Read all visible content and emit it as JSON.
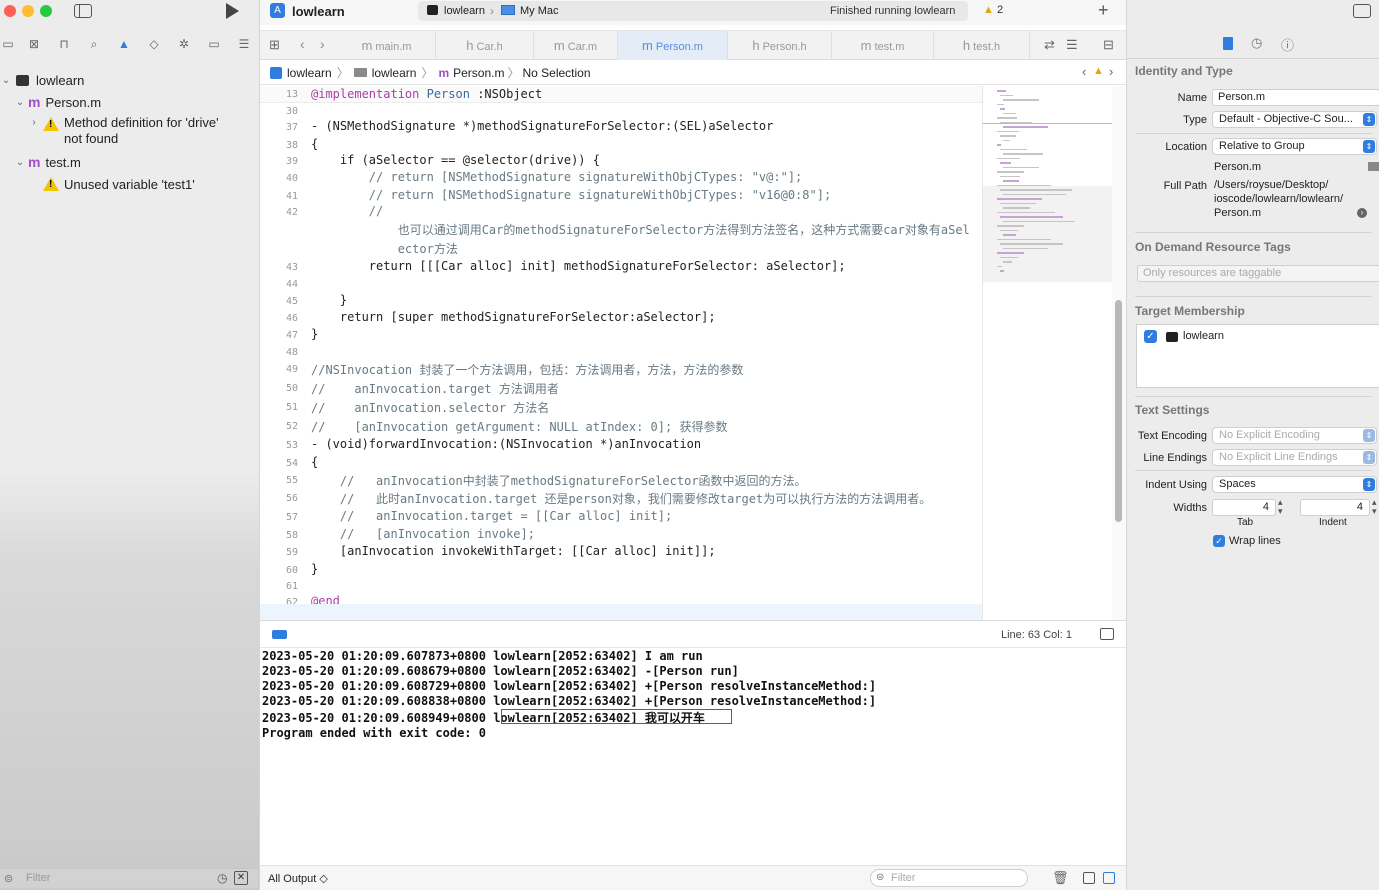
{
  "window": {
    "project": "lowlearn",
    "scheme_target": "lowlearn",
    "scheme_device": "My Mac",
    "status": "Finished running lowlearn",
    "warning_count": "2"
  },
  "navigator": {
    "root": "lowlearn",
    "items": [
      {
        "name": "Person.m",
        "kind": "file"
      },
      {
        "name": "Method definition for 'drive' not found",
        "kind": "warning"
      },
      {
        "name": "test.m",
        "kind": "file"
      },
      {
        "name": "Unused variable 'test1'",
        "kind": "warning"
      }
    ],
    "filter_placeholder": "Filter"
  },
  "tabs": [
    {
      "icon": "m",
      "label": "main.m"
    },
    {
      "icon": "h",
      "label": "Car.h"
    },
    {
      "icon": "m",
      "label": "Car.m"
    },
    {
      "icon": "m",
      "label": "Person.m",
      "active": true
    },
    {
      "icon": "h",
      "label": "Person.h"
    },
    {
      "icon": "m",
      "label": "test.m"
    },
    {
      "icon": "h",
      "label": "test.h"
    }
  ],
  "jumpbar": {
    "project": "lowlearn",
    "folder": "lowlearn",
    "file": "Person.m",
    "selection": "No Selection"
  },
  "code": {
    "sticky": {
      "line": "13",
      "text": "@implementation Person :NSObject"
    },
    "lines": [
      {
        "n": "30",
        "t": ""
      },
      {
        "n": "37",
        "t": "- (NSMethodSignature *)methodSignatureForSelector:(SEL)aSelector"
      },
      {
        "n": "38",
        "t": "{"
      },
      {
        "n": "39",
        "t": "    if (aSelector == @selector(drive)) {"
      },
      {
        "n": "40",
        "t": "        // return [NSMethodSignature signatureWithObjCTypes: \"v@:\"];"
      },
      {
        "n": "41",
        "t": "        // return [NSMethodSignature signatureWithObjCTypes: \"v16@0:8\"];"
      },
      {
        "n": "42",
        "t": "        //"
      },
      {
        "n": "",
        "t": "            也可以通过调用Car的methodSignatureForSelector方法得到方法签名，这种方式需要car对象有aSel"
      },
      {
        "n": "",
        "t": "            ector方法"
      },
      {
        "n": "43",
        "t": "        return [[[Car alloc] init] methodSignatureForSelector: aSelector];"
      },
      {
        "n": "44",
        "t": ""
      },
      {
        "n": "45",
        "t": "    }"
      },
      {
        "n": "46",
        "t": "    return [super methodSignatureForSelector:aSelector];"
      },
      {
        "n": "47",
        "t": "}"
      },
      {
        "n": "48",
        "t": ""
      },
      {
        "n": "49",
        "t": "//NSInvocation 封装了一个方法调用，包括：方法调用者，方法，方法的参数"
      },
      {
        "n": "50",
        "t": "//    anInvocation.target 方法调用者"
      },
      {
        "n": "51",
        "t": "//    anInvocation.selector 方法名"
      },
      {
        "n": "52",
        "t": "//    [anInvocation getArgument: NULL atIndex: 0]; 获得参数"
      },
      {
        "n": "53",
        "t": "- (void)forwardInvocation:(NSInvocation *)anInvocation"
      },
      {
        "n": "54",
        "t": "{"
      },
      {
        "n": "55",
        "t": "    //   anInvocation中封装了methodSignatureForSelector函数中返回的方法。"
      },
      {
        "n": "56",
        "t": "    //   此时anInvocation.target 还是person对象，我们需要修改target为可以执行方法的方法调用者。"
      },
      {
        "n": "57",
        "t": "    //   anInvocation.target = [[Car alloc] init];"
      },
      {
        "n": "58",
        "t": "    //   [anInvocation invoke];"
      },
      {
        "n": "59",
        "t": "    [anInvocation invokeWithTarget: [[Car alloc] init]];"
      },
      {
        "n": "60",
        "t": "}"
      },
      {
        "n": "61",
        "t": ""
      },
      {
        "n": "62",
        "t": "@end"
      },
      {
        "n": "63",
        "t": ""
      }
    ]
  },
  "cursor": "Line: 63  Col: 1",
  "console": {
    "lines": [
      "2023-05-20 01:20:09.607873+0800 lowlearn[2052:63402] I am run",
      "2023-05-20 01:20:09.608679+0800 lowlearn[2052:63402] -[Person run]",
      "2023-05-20 01:20:09.608729+0800 lowlearn[2052:63402] +[Person resolveInstanceMethod:]",
      "2023-05-20 01:20:09.608838+0800 lowlearn[2052:63402] +[Person resolveInstanceMethod:]",
      "2023-05-20 01:20:09.608949+0800 lowlearn[2052:63402] 我可以开车",
      "Program ended with exit code: 0"
    ],
    "output_selector": "All Output ◇",
    "filter_placeholder": "Filter"
  },
  "inspector": {
    "identity_title": "Identity and Type",
    "name_label": "Name",
    "name": "Person.m",
    "type_label": "Type",
    "type": "Default - Objective-C Sou...",
    "location_label": "Location",
    "location": "Relative to Group",
    "location_file": "Person.m",
    "fullpath_label": "Full Path",
    "fullpath": [
      "/Users/roysue/Desktop/",
      "ioscode/lowlearn/lowlearn/",
      "Person.m"
    ],
    "tags_title": "On Demand Resource Tags",
    "tags_placeholder": "Only resources are taggable",
    "membership_title": "Target Membership",
    "membership_target": "lowlearn",
    "text_title": "Text Settings",
    "encoding_label": "Text Encoding",
    "encoding": "No Explicit Encoding",
    "endings_label": "Line Endings",
    "endings": "No Explicit Line Endings",
    "indent_label": "Indent Using",
    "indent": "Spaces",
    "widths_label": "Widths",
    "tab_value": "4",
    "indent_value": "4",
    "tab_label": "Tab",
    "indent_sub_label": "Indent",
    "wrap_label": "Wrap lines"
  },
  "colors": {
    "accent": "#2f7de1",
    "warning": "#f5c400",
    "highlight_box": "#d0302a",
    "keyword": "#ad3da4",
    "type": "#3a6ba0"
  }
}
